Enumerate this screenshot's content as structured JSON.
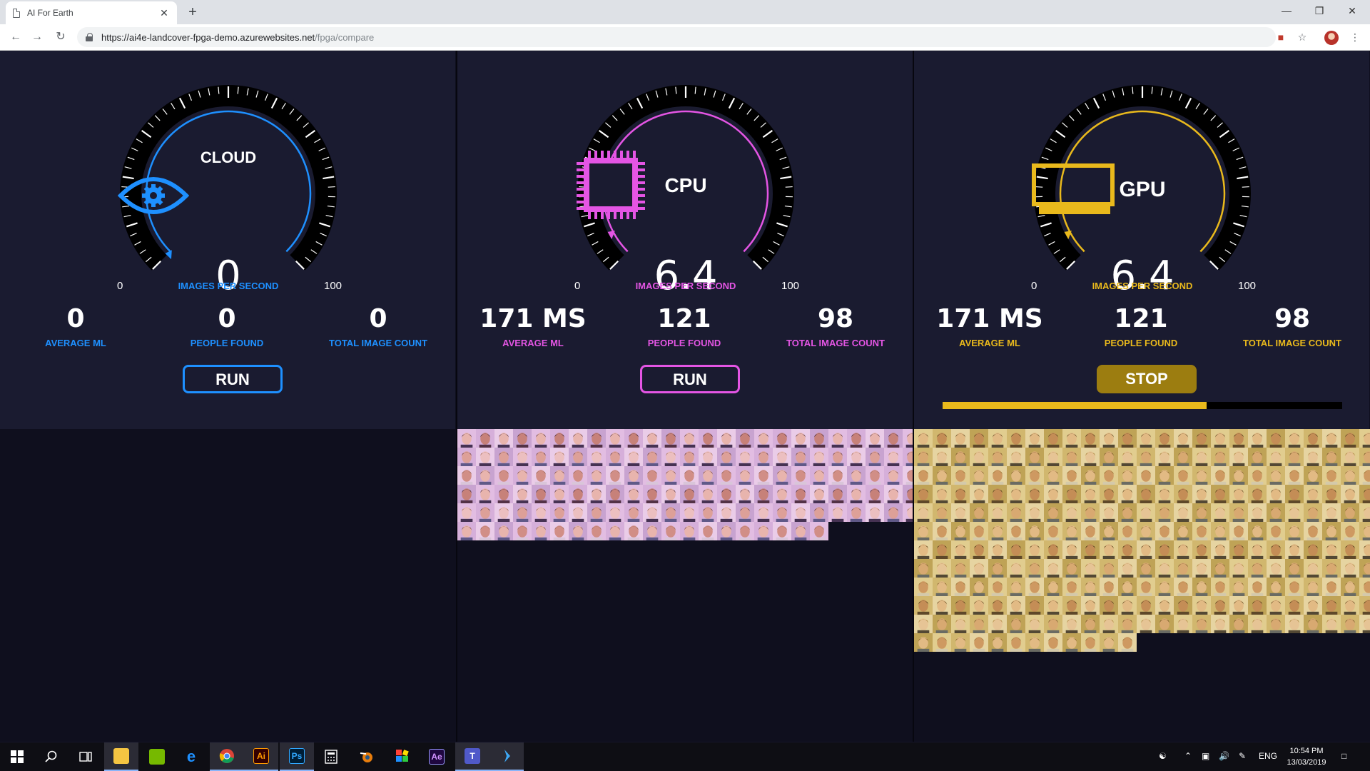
{
  "browser": {
    "tab_title": "AI For Earth",
    "url_host": "https://ai4e-landcover-fpga-demo.azurewebsites.net",
    "url_path": "/fpga/compare",
    "icons": [
      "back-icon",
      "forward-icon",
      "reload-icon",
      "lock-icon",
      "extension-icon",
      "star-icon",
      "profile-avatar",
      "menu-icon"
    ]
  },
  "colors": {
    "cloud": "#1e90ff",
    "cpu": "#e455e4",
    "gpu": "#e9b91c"
  },
  "panels": [
    {
      "title": "CLOUD",
      "icon": "eye-gear-icon",
      "gauge_value": "0",
      "gauge_unit": "IMAGES PER SECOND",
      "gauge_min": "0",
      "gauge_max": "100",
      "gauge_level": 0,
      "stats": [
        {
          "value": "0",
          "label": "AVERAGE ML"
        },
        {
          "value": "0",
          "label": "PEOPLE FOUND"
        },
        {
          "value": "0",
          "label": "TOTAL IMAGE COUNT"
        }
      ],
      "button": "RUN"
    },
    {
      "title": "CPU",
      "icon": "cpu-chip-icon",
      "gauge_value": "6.4",
      "gauge_unit": "IMAGES PER SECOND",
      "gauge_min": "0",
      "gauge_max": "100",
      "gauge_level": 0.064,
      "stats": [
        {
          "value": "171 MS",
          "label": "AVERAGE ML"
        },
        {
          "value": "121",
          "label": "PEOPLE FOUND"
        },
        {
          "value": "98",
          "label": "TOTAL IMAGE COUNT"
        }
      ],
      "button": "RUN"
    },
    {
      "title": "GPU",
      "icon": "gpu-card-icon",
      "gauge_value": "6.4",
      "gauge_unit": "IMAGES PER SECOND",
      "gauge_min": "0",
      "gauge_max": "100",
      "gauge_level": 0.064,
      "stats": [
        {
          "value": "171 MS",
          "label": "AVERAGE ML"
        },
        {
          "value": "121",
          "label": "PEOPLE FOUND"
        },
        {
          "value": "98",
          "label": "TOTAL IMAGE COUNT"
        }
      ],
      "button": "STOP",
      "progress": 0.66
    }
  ],
  "taskbar": {
    "apps": [
      "windows-start-icon",
      "search-icon",
      "task-view-icon",
      "file-explorer-icon",
      "nvidia-icon",
      "edge-icon",
      "chrome-icon",
      "illustrator-icon",
      "photoshop-icon",
      "calculator-icon",
      "blender-icon",
      "app-grid-icon",
      "after-effects-icon",
      "teams-icon",
      "azure-icon"
    ],
    "illustrator_label": "Ai",
    "photoshop_label": "Ps",
    "after_effects_label": "Ae",
    "teams_label": "T",
    "language": "ENG",
    "time": "10:54 PM",
    "date": "13/03/2019"
  }
}
